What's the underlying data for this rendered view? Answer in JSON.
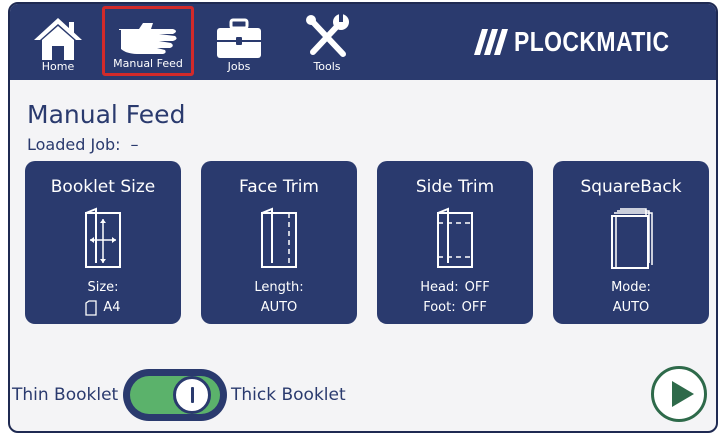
{
  "nav": {
    "home_label": "Home",
    "manual_feed_label": "Manual Feed",
    "jobs_label": "Jobs",
    "tools_label": "Tools",
    "active_color": "#d22a2a"
  },
  "brand": {
    "name": "PLOCKMATIC"
  },
  "page": {
    "title": "Manual Feed",
    "loaded_job_label": "Loaded Job:",
    "loaded_job_value": "–"
  },
  "cards": {
    "booklet_size": {
      "title": "Booklet Size",
      "line1": "Size:",
      "paper_icon": "paper-sheet-icon",
      "size_value": "A4"
    },
    "face_trim": {
      "title": "Face Trim",
      "line1": "Length:",
      "line2": "AUTO"
    },
    "side_trim": {
      "title": "Side Trim",
      "head_label": "Head:",
      "head_value": "OFF",
      "foot_label": "Foot:",
      "foot_value": "OFF"
    },
    "squareback": {
      "title": "SquareBack",
      "line1": "Mode:",
      "line2": "AUTO"
    }
  },
  "booklet_toggle": {
    "left_label": "Thin Booklet",
    "right_label": "Thick Booklet",
    "state": "thick"
  },
  "colors": {
    "primary": "#2a3a6e",
    "toggle_on": "#5bb26b",
    "play_accent": "#2e6a4a"
  }
}
